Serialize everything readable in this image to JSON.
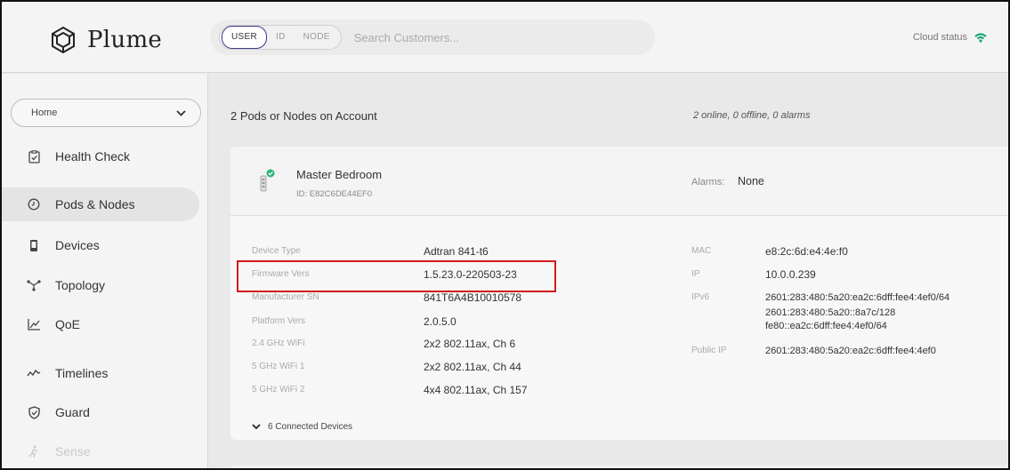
{
  "brand": {
    "name": "Plume"
  },
  "search": {
    "modes": [
      "USER",
      "ID",
      "NODE"
    ],
    "active_mode": "USER",
    "placeholder": "Search Customers..."
  },
  "cloud_status": {
    "label": "Cloud status",
    "color": "#1aa37a"
  },
  "sidebar": {
    "home_select": "Home",
    "items": [
      {
        "label": "Health Check",
        "icon": "clipboard-check-icon"
      },
      {
        "label": "Pods & Nodes",
        "icon": "clock-circle-icon",
        "active": true
      },
      {
        "label": "Devices",
        "icon": "phone-icon"
      },
      {
        "label": "Topology",
        "icon": "topology-icon"
      },
      {
        "label": "QoE",
        "icon": "chart-line-icon"
      },
      {
        "label": "Timelines",
        "icon": "wave-icon"
      },
      {
        "label": "Guard",
        "icon": "shield-icon"
      },
      {
        "label": "Sense",
        "icon": "motion-icon",
        "disabled": true
      }
    ]
  },
  "main": {
    "title": "2 Pods or Nodes on Account",
    "summary": "2 online, 0 offline, 0 alarms",
    "pod": {
      "name": "Master Bedroom",
      "id": "ID: E82C6DE44EF0",
      "alarms_label": "Alarms:",
      "alarms_value": "None",
      "status_color": "#2bb673"
    },
    "details_left": [
      {
        "label": "Device Type",
        "value": "Adtran 841-t6"
      },
      {
        "label": "Firmware Vers",
        "value": "1.5.23.0-220503-23"
      },
      {
        "label": "Manufacturer SN",
        "value": "841T6A4B10010578"
      },
      {
        "label": "Platform Vers",
        "value": "2.0.5.0"
      },
      {
        "label": "2.4 GHz WiFi",
        "value": "2x2 802.11ax, Ch 6"
      },
      {
        "label": "5 GHz WiFi 1",
        "value": "2x2 802.11ax, Ch 44"
      },
      {
        "label": "5 GHz WiFi 2",
        "value": "4x4 802.11ax, Ch 157"
      }
    ],
    "details_right": {
      "mac_label": "MAC",
      "mac": "e8:2c:6d:e4:4e:f0",
      "ip_label": "IP",
      "ip": "10.0.0.239",
      "ipv6_label": "IPv6",
      "ipv6": [
        "2601:283:480:5a20:ea2c:6dff:fee4:4ef0/64",
        "2601:283:480:5a20::8a7c/128",
        "fe80::ea2c:6dff:fee4:4ef0/64"
      ],
      "public_ip_label": "Public IP",
      "public_ip": "2601:283:480:5a20:ea2c:6dff:fee4:4ef0"
    },
    "connected_devices": "6 Connected Devices",
    "highlight_color": "#d11a1a"
  }
}
